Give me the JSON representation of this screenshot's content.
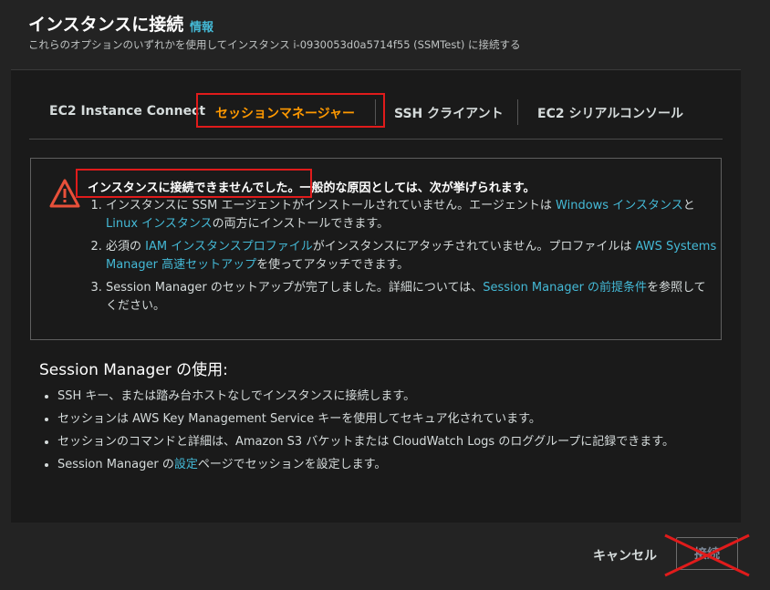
{
  "header": {
    "title": "インスタンスに接続",
    "info_link": "情報",
    "subtitle": "これらのオプションのいずれかを使用してインスタンス i-0930053d0a5714f55 (SSMTest) に接続する"
  },
  "tabs": [
    {
      "label": "EC2 Instance Connect",
      "active": false
    },
    {
      "label": "セッションマネージャー",
      "active": true
    },
    {
      "label": "SSH クライアント",
      "active": false
    },
    {
      "label": "EC2 シリアルコンソール",
      "active": false
    }
  ],
  "alert": {
    "icon": "warning-triangle-icon",
    "title_highlight": "インスタンスに接続できませんでした。",
    "title_rest": "一般的な原因としては、次が挙げられます。",
    "item1": {
      "t1": "インスタンスに SSM エージェントがインストールされていません。エージェントは ",
      "link1": "Windows インスタンス",
      "t2": "と ",
      "link2": "Linux インスタンス",
      "t3": "の両方にインストールできます。"
    },
    "item2": {
      "t1": "必須の ",
      "link1": "IAM インスタンスプロファイル",
      "t2": "がインスタンスにアタッチされていません。プロファイルは ",
      "link2": "AWS Systems Manager 高速セットアップ",
      "t3": "を使ってアタッチできます。"
    },
    "item3": {
      "t1": "Session Manager のセットアップが完了しました。詳細については、",
      "link1": "Session Manager の前提条件",
      "t2": "を参照してください。"
    }
  },
  "usage": {
    "title": "Session Manager の使用:",
    "items": [
      "SSH キー、または踏み台ホストなしでインスタンスに接続します。",
      "セッションは AWS Key Management Service キーを使用してセキュア化されています。",
      "セッションのコマンドと詳細は、Amazon S3 バケットまたは CloudWatch Logs のロググループに記録できます。"
    ],
    "item4": {
      "t1": "Session Manager の",
      "link": "設定",
      "t2": "ページでセッションを設定します。"
    }
  },
  "footer": {
    "cancel": "キャンセル",
    "connect": "接続"
  },
  "colors": {
    "accent": "#ff9900",
    "link": "#44b9d6",
    "annotation_red": "#e01b1b",
    "warning": "#e8503a"
  }
}
